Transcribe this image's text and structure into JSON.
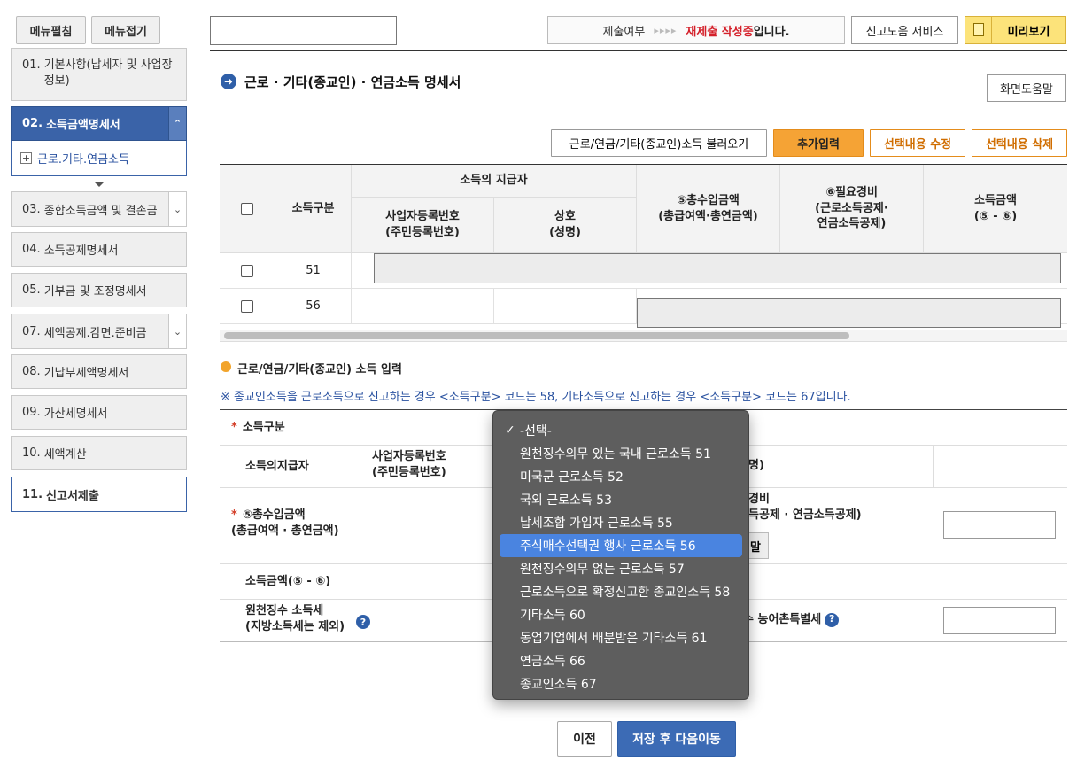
{
  "sidebar": {
    "expand_label": "메뉴펼침",
    "collapse_label": "메뉴접기",
    "items": [
      {
        "num": "01.",
        "label": "기본사항(납세자 및 사업장정보)"
      },
      {
        "num": "02.",
        "label": "소득금액명세서"
      },
      {
        "num": "03.",
        "label": "종합소득금액 및 결손금"
      },
      {
        "num": "04.",
        "label": "소득공제명세서"
      },
      {
        "num": "05.",
        "label": "기부금 및 조정명세서"
      },
      {
        "num": "07.",
        "label": "세액공제.감면.준비금"
      },
      {
        "num": "08.",
        "label": "기납부세액명세서"
      },
      {
        "num": "09.",
        "label": "가산세명세서"
      },
      {
        "num": "10.",
        "label": "세액계산"
      },
      {
        "num": "11.",
        "label": "신고서제출"
      }
    ],
    "submenu_label": "근로.기타.연금소득"
  },
  "topbar": {
    "status_prefix": "제출여부",
    "status_arrows": "▸▸▸▸",
    "status_highlight": "재제출 작성중",
    "status_suffix": "입니다.",
    "help_service_label": "신고도움 서비스",
    "preview_label": "미리보기"
  },
  "page": {
    "title": "근로 · 기타(종교인) · 연금소득 명세서",
    "screen_help_label": "화면도움말"
  },
  "actions": {
    "load_label": "근로/연금/기타(종교인)소득 불러오기",
    "add_label": "추가입력",
    "edit_label": "선택내용 수정",
    "delete_label": "선택내용 삭제"
  },
  "table": {
    "headers": {
      "category": "소득구분",
      "payer_group": "소득의 지급자",
      "biz_no": "사업자등록번호\n(주민등록번호)",
      "name": "상호\n(성명)",
      "total": "⑤총수입금액\n(총급여액·총연금액)",
      "expense": "⑥필요경비\n(근로소득공제·\n연금소득공제)",
      "income": "소득금액\n(⑤ - ⑥)"
    },
    "rows": [
      {
        "code": "51"
      },
      {
        "code": "56"
      }
    ]
  },
  "input_section": {
    "title": "근로/연금/기타(종교인) 소득 입력",
    "note": "※ 종교인소득을 근로소득으로 신고하는 경우 <소득구분> 코드는 58, 기타소득으로 신고하는 경우 <소득구분> 코드는 67입니다.",
    "category_label": "소득구분",
    "payer_label": "소득의지급자",
    "biz_no_label": "사업자등록번호\n(주민등록번호)",
    "name_label_partial": "명)",
    "total_label": "⑤총수입금액\n(총급여액 · 총연금액)",
    "expense_label_partial": "경비\n득공제 · 연금소득공제)",
    "expense_btn_partial": "말",
    "income_label": "소득금액(⑤ - ⑥)",
    "withholding_label": "원천징수 소득세\n(지방소득세는 제외)",
    "rural_tax_label_partial": "수 농어촌특별세"
  },
  "dropdown": {
    "selected_index": 0,
    "highlighted_index": 5,
    "options": [
      "-선택-",
      "원천징수의무 있는 국내 근로소득 51",
      "미국군 근로소득 52",
      "국외 근로소득 53",
      "납세조합 가입자 근로소득 55",
      "주식매수선택권 행사 근로소득 56",
      "원천징수의무 없는 근로소득 57",
      "근로소득으로 확정신고한 종교인소득 58",
      "기타소득 60",
      "동업기업에서 배분받은 기타소득 61",
      "연금소득 66",
      "종교인소득 67"
    ]
  },
  "footer": {
    "prev_label": "이전",
    "next_label": "저장 후 다음이동"
  },
  "colors": {
    "accent_blue": "#3a63a8",
    "accent_orange": "#f5a335",
    "status_red": "#d4202a"
  }
}
